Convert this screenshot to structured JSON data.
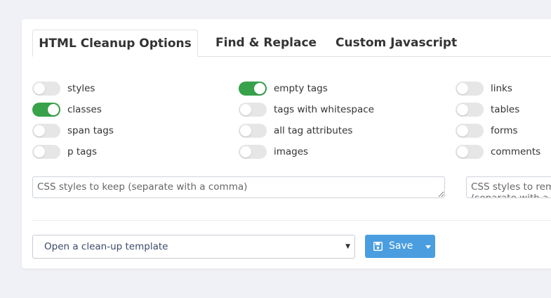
{
  "tabs": [
    {
      "label": "HTML Cleanup Options",
      "active": true
    },
    {
      "label": "Find & Replace",
      "active": false
    },
    {
      "label": "Custom Javascript",
      "active": false
    }
  ],
  "options": [
    {
      "label": "styles",
      "on": false
    },
    {
      "label": "classes",
      "on": true
    },
    {
      "label": "span tags",
      "on": false
    },
    {
      "label": "p tags",
      "on": false
    },
    {
      "label": "empty tags",
      "on": true
    },
    {
      "label": "tags with whitespace",
      "on": false
    },
    {
      "label": "all tag attributes",
      "on": false
    },
    {
      "label": "images",
      "on": false
    },
    {
      "label": "links",
      "on": false
    },
    {
      "label": "tables",
      "on": false
    },
    {
      "label": "forms",
      "on": false
    },
    {
      "label": "comments",
      "on": false
    }
  ],
  "inputs": {
    "keep_placeholder": "CSS styles to keep (separate with a comma)",
    "remove_placeholder": "CSS styles to remove (separate with a comma)"
  },
  "template_select": {
    "value": "Open a clean-up template"
  },
  "save_button": {
    "label": "Save"
  },
  "colors": {
    "accent": "#4a9ee0",
    "toggle_on": "#37a24a",
    "toggle_off": "#e6e6e6"
  }
}
